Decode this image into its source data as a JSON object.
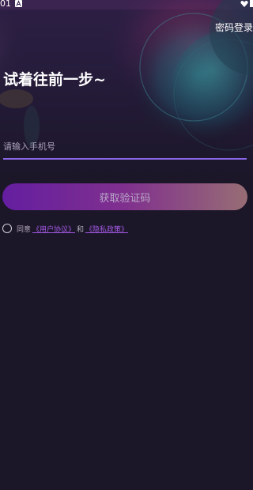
{
  "status_bar": {
    "time": "01",
    "app_icon": "font-a-icon",
    "right_icon": "heart-icon",
    "battery_icon": "battery-icon"
  },
  "header": {
    "password_login_label": "密码登录"
  },
  "main": {
    "title": "试着往前一步~",
    "phone_input": {
      "value": "",
      "placeholder": "请输入手机号"
    },
    "get_code_label": "获取验证码"
  },
  "agreement": {
    "prefix": "同意",
    "user_agreement_link": "《用户协议》",
    "and_text": "和",
    "privacy_policy_link": "《隐私政策》"
  },
  "colors": {
    "background": "#1b1628",
    "accent": "#8a67e8",
    "button_gradient_start": "#641ea0",
    "button_gradient_end": "#976d74",
    "link": "#a55ae6"
  }
}
